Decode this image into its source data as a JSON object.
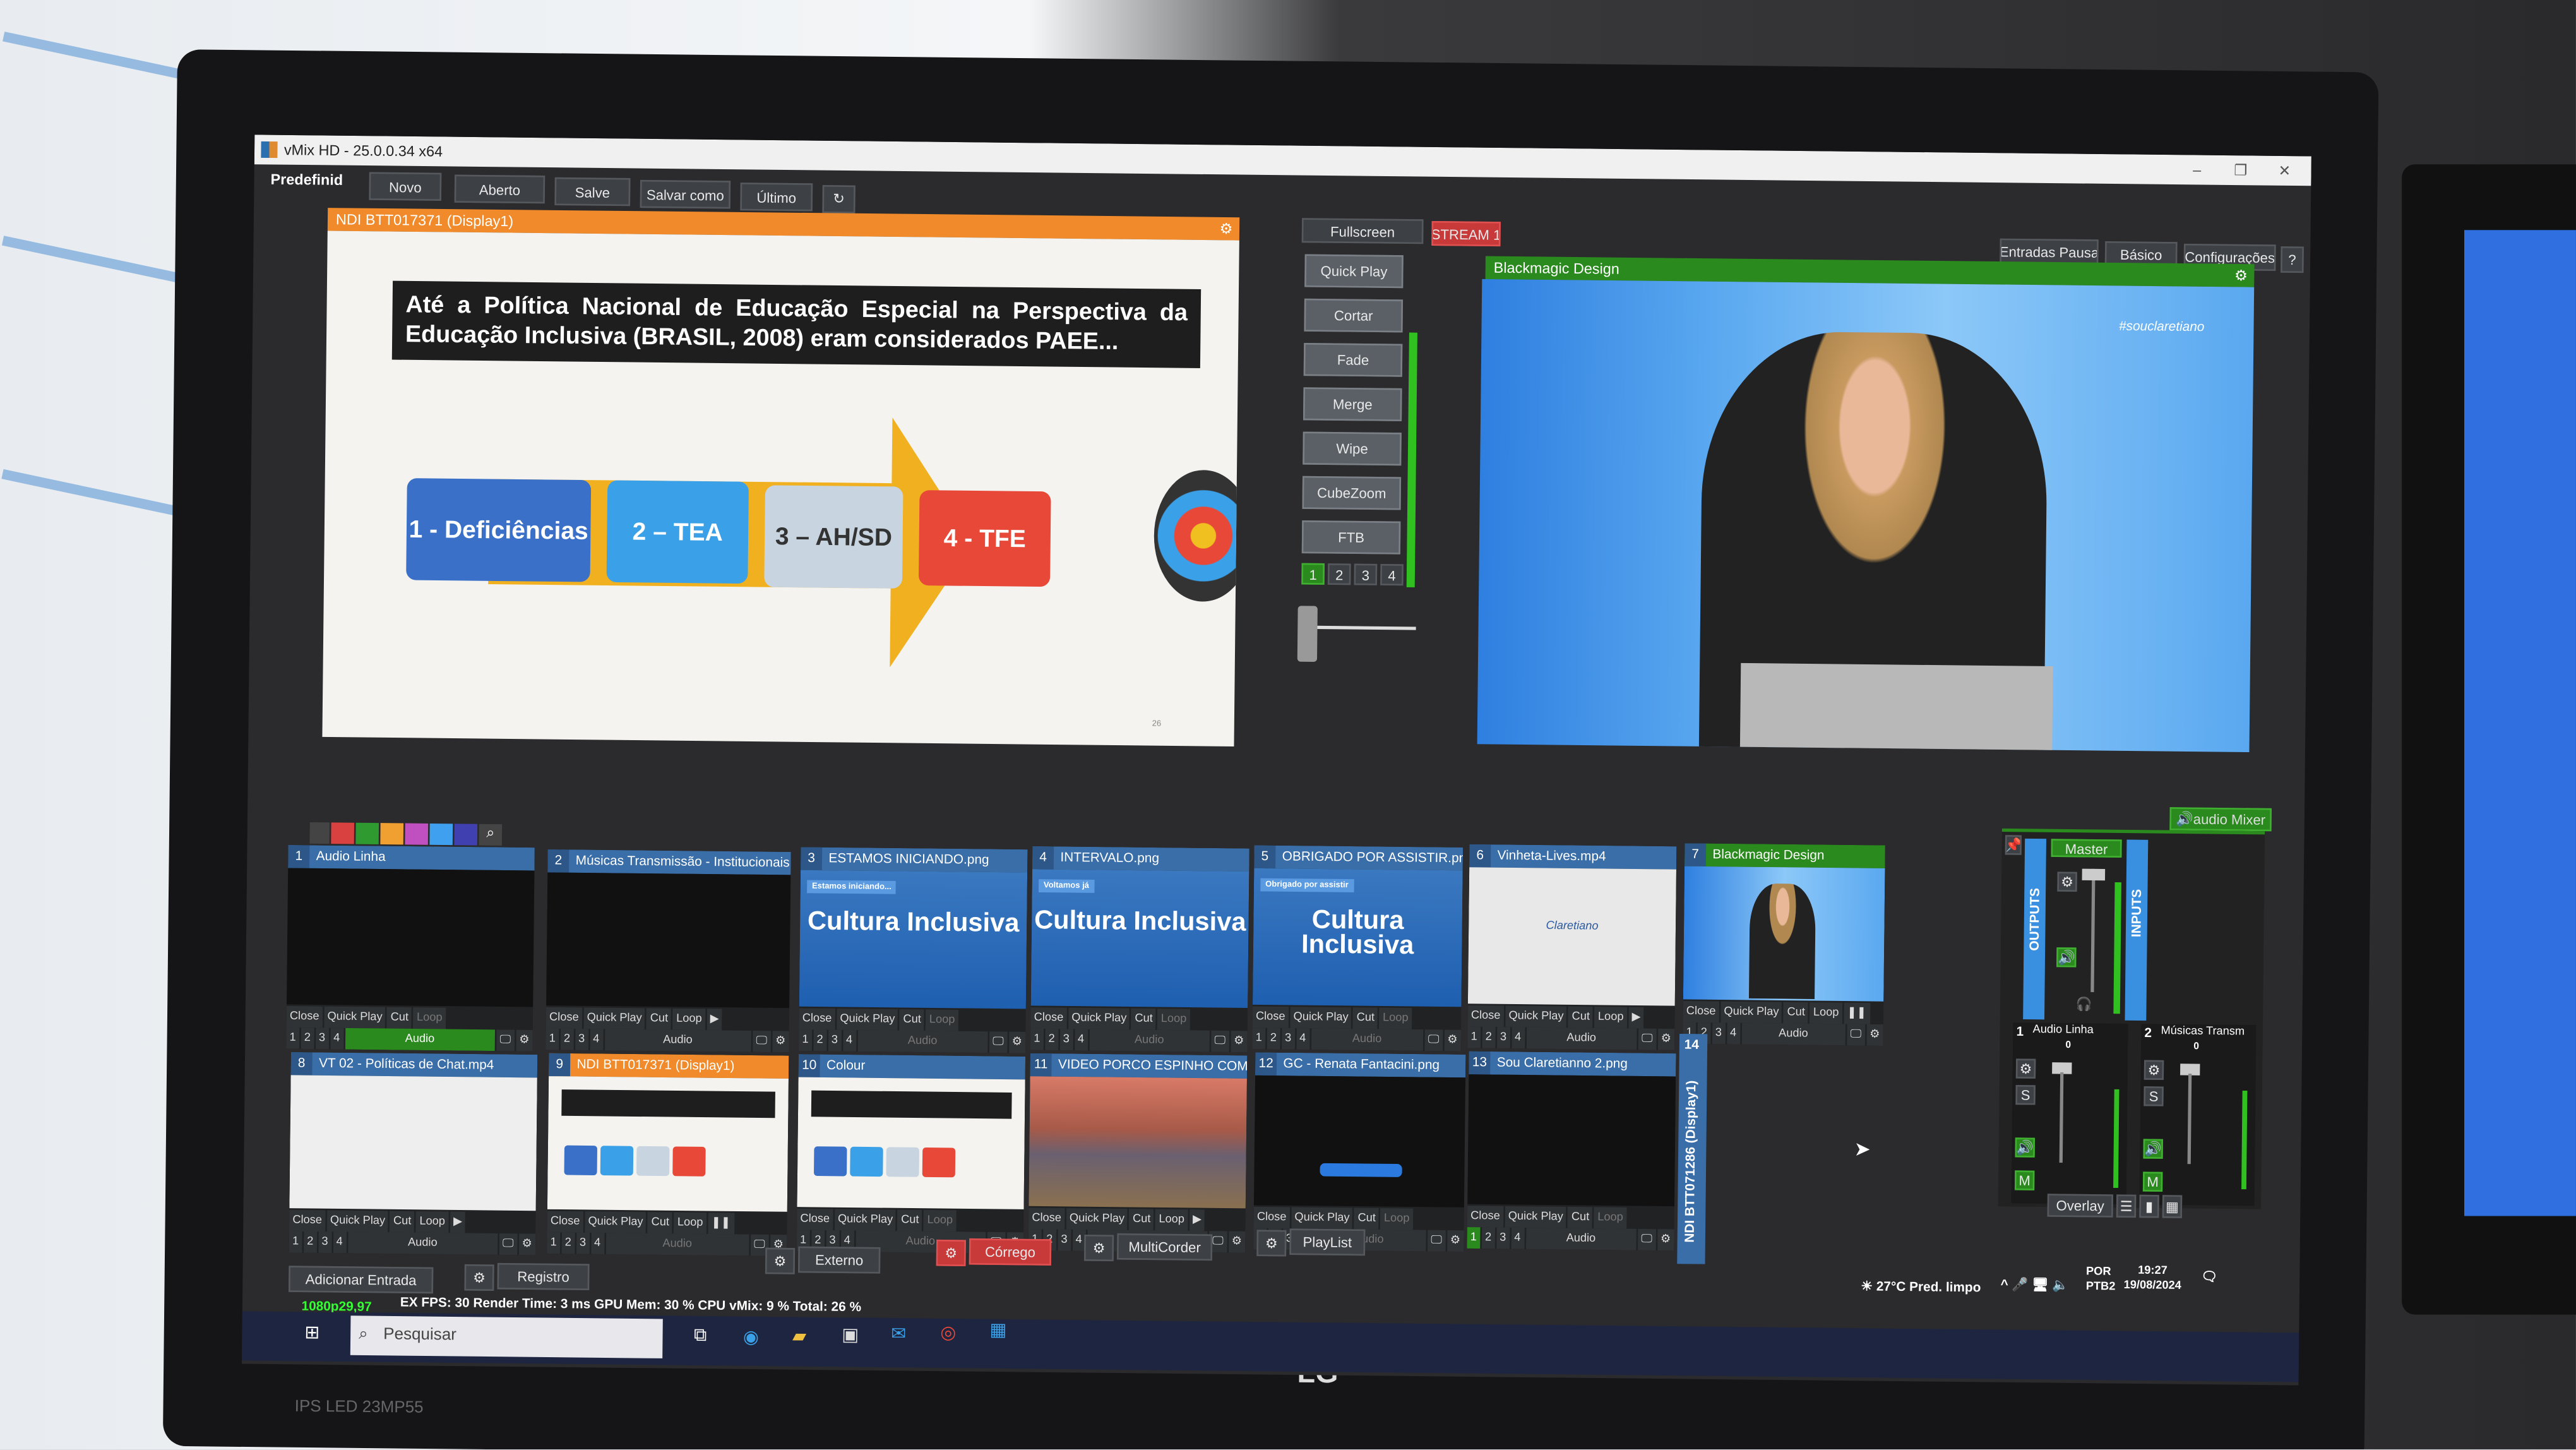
{
  "window": {
    "title": "vMix HD - 25.0.0.34 x64",
    "minimize": "–",
    "maximize": "❐",
    "close": "✕"
  },
  "toolbar": {
    "preset": "Predefinid",
    "new": "Novo",
    "open": "Aberto",
    "save": "Salve",
    "save_as": "Salvar como",
    "last": "Último",
    "pause_inputs": "Entradas Pausa",
    "basic": "Básico",
    "settings": "Configurações",
    "help": "?"
  },
  "preview": {
    "title": "NDI BTT017371 (Display1)",
    "slide_heading": "Até a Política Nacional de Educação Especial na Perspectiva da Educação Inclusiva (BRASIL, 2008) eram considerados PAEE...",
    "boxes": [
      "1 - Deficiências",
      "2 – TEA",
      "3 – AH/SD",
      "4 - TFE"
    ],
    "page": "26"
  },
  "transitions": {
    "fullscreen": "Fullscreen",
    "stream": "STREAM 1",
    "quick_play": "Quick Play",
    "cut": "Cortar",
    "fade": "Fade",
    "merge": "Merge",
    "wipe": "Wipe",
    "cubezoom": "CubeZoom",
    "ftb": "FTB",
    "slots": [
      "1",
      "2",
      "3",
      "4"
    ],
    "active_slot": "1",
    "tbar_position": 0
  },
  "output": {
    "title": "Blackmagic Design",
    "hashtag": "#souclaretiano"
  },
  "input_colors": [
    "#d94040",
    "#2f9a2f",
    "#f0a030",
    "#c050c0",
    "#40a0f0",
    "#4040b0"
  ],
  "inputs": [
    {
      "n": "1",
      "name": "Audio Linha",
      "type": "black",
      "audio_on": true
    },
    {
      "n": "2",
      "name": "Músicas Transmissão - Institucionais.mp",
      "type": "black",
      "play": true
    },
    {
      "n": "3",
      "name": "ESTAMOS INICIANDO.png",
      "type": "cultura",
      "tag": "Estamos iniciando..."
    },
    {
      "n": "4",
      "name": "INTERVALO.png",
      "type": "cultura",
      "tag": "Voltamos já"
    },
    {
      "n": "5",
      "name": "OBRIGADO POR ASSISTIR.png",
      "type": "cultura",
      "tag": "Obrigado por assistir"
    },
    {
      "n": "6",
      "name": "Vinheta-Lives.mp4",
      "type": "claretiano",
      "logo": "Claretiano",
      "play": true
    },
    {
      "n": "7",
      "name": "Blackmagic Design",
      "type": "camera",
      "live": true,
      "pause": true
    },
    {
      "n": "8",
      "name": "VT 02 - Políticas de Chat.mp4",
      "type": "white",
      "play": true
    },
    {
      "n": "9",
      "name": "NDI BTT017371 (Display1)",
      "type": "slide",
      "preview": true,
      "pause": true
    },
    {
      "n": "10",
      "name": "Colour",
      "type": "slide"
    },
    {
      "n": "11",
      "name": "VIDEO PORCO ESPINHO COM AUD",
      "type": "autumn",
      "play": true
    },
    {
      "n": "12",
      "name": "GC - Renata Fantacini.png",
      "type": "gc"
    },
    {
      "n": "13",
      "name": "Sou Claretianno 2.png",
      "type": "black",
      "slot_on": "1"
    }
  ],
  "collapsed_input": {
    "n": "14",
    "name": "NDI BTT071286 (Display1)"
  },
  "cell_labels": {
    "close": "Close",
    "quick_play": "Quick Play",
    "cut": "Cut",
    "loop": "Loop",
    "audio": "Audio",
    "slots": [
      "1",
      "2",
      "3",
      "4"
    ]
  },
  "mixer": {
    "tab": "audio Mixer",
    "master": "Master",
    "outputs": "OUTPUTS",
    "inputs": "INPUTS",
    "channels": [
      {
        "n": "1",
        "name": "Audio Linha",
        "balance": "0"
      },
      {
        "n": "2",
        "name": "Músicas Transm",
        "balance": "0"
      }
    ],
    "solo": "S",
    "mute": "M",
    "overlay": "Overlay"
  },
  "bottom": {
    "add_input": "Adicionar Entrada",
    "log": "Registro",
    "external": "Externo",
    "stream": "Córrego",
    "multicorder": "MultiCorder",
    "playlist": "PlayList"
  },
  "status": {
    "format": "1080p29,97",
    "stats": "EX FPS: 30 Render Time: 3 ms GPU Mem: 30 % CPU vMix: 9 % Total: 26 %"
  },
  "taskbar": {
    "search_placeholder": "Pesquisar",
    "weather": "27°C Pred. limpo",
    "lang1": "POR",
    "lang2": "PTB2",
    "time": "19:27",
    "date": "19/08/2024"
  },
  "monitor": {
    "brand": "LG",
    "model": "IPS LED 23MP55"
  },
  "colors": {
    "preview": "#f08a2a",
    "program": "#2a8a1e",
    "panel": "#2b2b2d",
    "accent": "#3a6ea8",
    "stream": "#c8393a"
  }
}
